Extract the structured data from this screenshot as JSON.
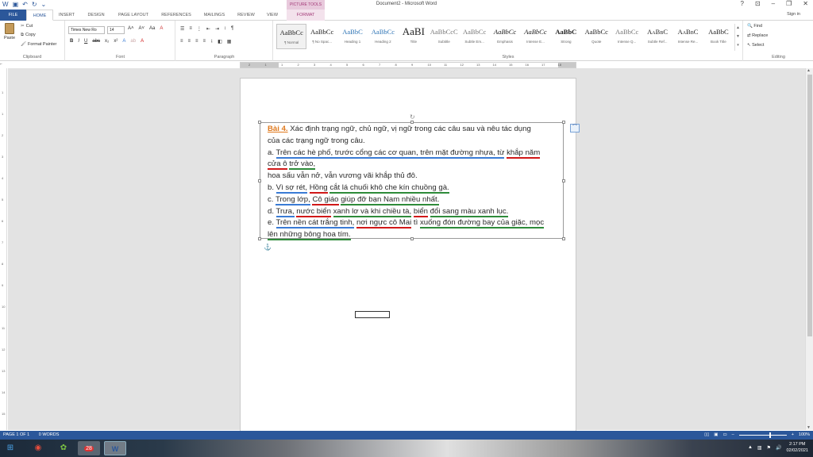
{
  "titlebar": {
    "title": "Document2 - Microsoft Word",
    "context_header": "PICTURE TOOLS",
    "help": "?",
    "restore_ribbon": "⊡",
    "minimize": "–",
    "maximize": "❐",
    "close": "✕"
  },
  "tabs": {
    "file": "FILE",
    "home": "HOME",
    "insert": "INSERT",
    "design": "DESIGN",
    "page_layout": "PAGE LAYOUT",
    "references": "REFERENCES",
    "mailings": "MAILINGS",
    "review": "REVIEW",
    "view": "VIEW",
    "format": "FORMAT",
    "sign_in": "Sign in"
  },
  "clipboard": {
    "paste": "Paste",
    "cut": "Cut",
    "copy": "Copy",
    "format_painter": "Format Painter",
    "label": "Clipboard"
  },
  "font": {
    "name": "Times New Ro",
    "size": "14",
    "label": "Font"
  },
  "paragraph": {
    "label": "Paragraph"
  },
  "styles": {
    "label": "Styles",
    "items": [
      {
        "preview": "AaBbCc",
        "name": "¶ Normal"
      },
      {
        "preview": "AaBbCc",
        "name": "¶ No Spac..."
      },
      {
        "preview": "AaBbC",
        "name": "Heading 1"
      },
      {
        "preview": "AaBbCc",
        "name": "Heading 2"
      },
      {
        "preview": "AaBI",
        "name": "Title"
      },
      {
        "preview": "AaBbCcC",
        "name": "Subtitle"
      },
      {
        "preview": "AaBbCc",
        "name": "Subtle Em..."
      },
      {
        "preview": "AaBbCc",
        "name": "Emphasis"
      },
      {
        "preview": "AaBbCc",
        "name": "Intense E..."
      },
      {
        "preview": "AaBbC",
        "name": "Strong"
      },
      {
        "preview": "AaBbCc",
        "name": "Quote"
      },
      {
        "preview": "AaBbCc",
        "name": "Intense Q..."
      },
      {
        "preview": "AaBbC",
        "name": "Subtle Ref..."
      },
      {
        "preview": "AaBbC",
        "name": "Intense Re..."
      },
      {
        "preview": "AaBbC",
        "name": "Book Title"
      }
    ]
  },
  "editing": {
    "find": "Find",
    "replace": "Replace",
    "select": "Select",
    "label": "Editing"
  },
  "ruler": {
    "ticks": [
      "2",
      "1",
      "1",
      "2",
      "3",
      "4",
      "5",
      "6",
      "7",
      "8",
      "9",
      "10",
      "11",
      "12",
      "13",
      "14",
      "15",
      "16",
      "17",
      "18"
    ],
    "vticks": [
      "1",
      "1",
      "2",
      "3",
      "4",
      "5",
      "6",
      "7",
      "8",
      "9",
      "10",
      "11",
      "12",
      "13",
      "14",
      "15"
    ]
  },
  "document": {
    "lines": [
      {
        "parts": [
          {
            "t": "Bài 4.",
            "c": "bai"
          },
          {
            "t": " Xác định trạng ngữ, chủ ngữ, vị ngữ trong các câu sau và nêu tác dụng",
            "c": ""
          }
        ]
      },
      {
        "parts": [
          {
            "t": "của các trạng ngữ trong câu.",
            "c": ""
          }
        ]
      },
      {
        "parts": [
          {
            "t": "a. ",
            "c": ""
          },
          {
            "t": "Trên các hè phố, trước cổng các cơ quan, trên mặt đường nhựa, từ",
            "c": "ub"
          },
          {
            "t": " ",
            "c": ""
          },
          {
            "t": "khắp năm",
            "c": "ur"
          }
        ]
      },
      {
        "parts": [
          {
            "t": "cửa ô",
            "c": "ur"
          },
          {
            "t": " ",
            "c": ""
          },
          {
            "t": "trở vào,",
            "c": "ug"
          }
        ]
      },
      {
        "parts": [
          {
            "t": "hoa sấu vẫn nở, vẫn vương vãi khắp thủ đô.",
            "c": ""
          }
        ]
      },
      {
        "parts": [
          {
            "t": "b. ",
            "c": ""
          },
          {
            "t": "Vì sợ rét,",
            "c": "ub"
          },
          {
            "t": " ",
            "c": ""
          },
          {
            "t": "Hồng",
            "c": "ur"
          },
          {
            "t": " ",
            "c": ""
          },
          {
            "t": "cắt lá chuối khô che kín chuồng gà.",
            "c": "ug"
          }
        ]
      },
      {
        "parts": [
          {
            "t": "c. ",
            "c": ""
          },
          {
            "t": "Trong lớp,",
            "c": "ub"
          },
          {
            "t": " ",
            "c": ""
          },
          {
            "t": "Cô giáo",
            "c": "ur"
          },
          {
            "t": " ",
            "c": ""
          },
          {
            "t": "giúp đỡ bạn Nam nhiều nhất.",
            "c": "ug"
          }
        ]
      },
      {
        "parts": [
          {
            "t": "d. ",
            "c": ""
          },
          {
            "t": "Trưa,",
            "c": "ub"
          },
          {
            "t": " ",
            "c": ""
          },
          {
            "t": "nước biển",
            "c": "ur"
          },
          {
            "t": " ",
            "c": ""
          },
          {
            "t": "xanh lơ và khi chiều tà,",
            "c": "ug"
          },
          {
            "t": " ",
            "c": ""
          },
          {
            "t": "biển",
            "c": "ur"
          },
          {
            "t": " ",
            "c": ""
          },
          {
            "t": "đổi sang màu xanh lục.",
            "c": "ug"
          }
        ]
      },
      {
        "parts": [
          {
            "t": "e. ",
            "c": ""
          },
          {
            "t": "Trên nền cát trắng tinh,",
            "c": "ub"
          },
          {
            "t": " ",
            "c": ""
          },
          {
            "t": "nơi ngực cô Mai",
            "c": "ur"
          },
          {
            "t": " tì ",
            "c": ""
          },
          {
            "t": "xuống đón đường bay của giặc, mọc",
            "c": "ug"
          }
        ]
      },
      {
        "parts": [
          {
            "t": "lên những bông hoa tím.",
            "c": "ug"
          }
        ]
      }
    ]
  },
  "status": {
    "page": "PAGE 1 OF 1",
    "words": "0 WORDS",
    "zoom": "100%"
  },
  "taskbar": {
    "time": "2:17 PM",
    "date": "02/02/2021",
    "badge": "28"
  }
}
